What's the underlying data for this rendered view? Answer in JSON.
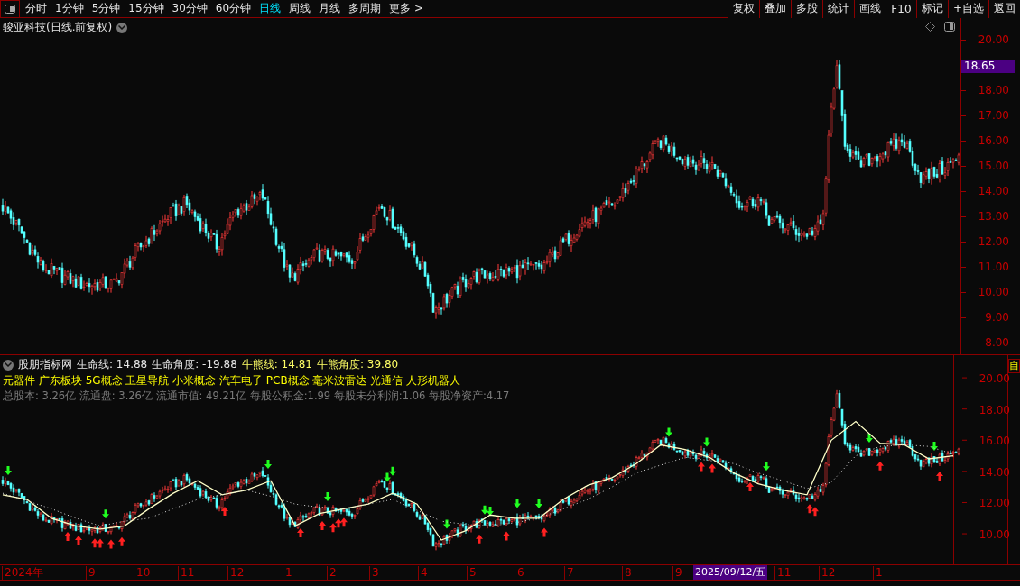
{
  "toolbar": {
    "periods": [
      {
        "label": "分时",
        "selected": false
      },
      {
        "label": "1分钟",
        "selected": false
      },
      {
        "label": "5分钟",
        "selected": false
      },
      {
        "label": "15分钟",
        "selected": false
      },
      {
        "label": "30分钟",
        "selected": false
      },
      {
        "label": "60分钟",
        "selected": false
      },
      {
        "label": "日线",
        "selected": true
      },
      {
        "label": "周线",
        "selected": false
      },
      {
        "label": "月线",
        "selected": false
      },
      {
        "label": "多周期",
        "selected": false
      }
    ],
    "more": "更多 >",
    "buttons": [
      "复权",
      "叠加",
      "多股",
      "统计",
      "画线",
      "F10",
      "标记",
      "+自选",
      "返回"
    ]
  },
  "main_chart": {
    "title": "骏亚科技(日线.前复权)",
    "price_axis": [
      "20.00",
      "18.00",
      "17.00",
      "16.00",
      "15.00",
      "14.00",
      "13.00",
      "12.00",
      "11.00",
      "10.00",
      "9.00",
      "8.00"
    ],
    "current_price": "18.65"
  },
  "indicator": {
    "name": "股朋指标网",
    "readings": [
      {
        "label": "生命线: 14.88",
        "color": "#e8e8e8"
      },
      {
        "label": "生命角度: -19.88",
        "color": "#e8e8e8"
      },
      {
        "label": "牛熊线: 14.81",
        "color": "#ffff66"
      },
      {
        "label": "牛熊角度: 39.80",
        "color": "#ffff66"
      }
    ],
    "concepts": "元器件 广东板块 5G概念 卫星导航 小米概念 汽车电子 PCB概念 毫米波雷达 光通信 人形机器人",
    "fundamentals": "总股本: 3.26亿 流通盘: 3.26亿 流通市值: 49.21亿 每股公积金:1.99 每股未分利润:1.06 每股净资产:4.17",
    "chart_data": {
      "type": "line",
      "ylim": [
        7.98,
        21.45
      ],
      "yticks": [
        {
          "value": 20,
          "label": "20.00"
        },
        {
          "value": 18,
          "label": "18.00"
        },
        {
          "value": 16,
          "label": "16.00"
        },
        {
          "value": 14,
          "label": "14.00"
        },
        {
          "value": 12,
          "label": "12.00"
        },
        {
          "value": 10,
          "label": "10.00"
        }
      ],
      "series": [
        {
          "color": "#ffffc8",
          "values": [
            12.5,
            12.2,
            11.0,
            10.5,
            10.3,
            10.5,
            11.6,
            12.6,
            13.4,
            12.5,
            12.8,
            13.4,
            10.5,
            11.3,
            11.6,
            11.9,
            12.6,
            11.9,
            9.6,
            10.2,
            11.2,
            11.0,
            11.0,
            12.2,
            13.1,
            13.6,
            14.5,
            15.7,
            15.4,
            14.9,
            13.9,
            13.2,
            12.8,
            12.5,
            16.0,
            17.2,
            15.8,
            15.7,
            14.8,
            15.0
          ]
        },
        {
          "color": "#dddddd",
          "line_style": "dotted",
          "values": [
            12.6,
            12.1,
            11.6,
            11.0,
            10.5,
            10.8,
            11.0,
            11.6,
            12.2,
            12.5,
            12.8,
            12.4,
            11.9,
            11.7,
            11.6,
            11.9,
            12.2,
            11.5,
            10.8,
            10.6,
            10.5,
            10.7,
            11.0,
            11.6,
            12.2,
            13.0,
            13.9,
            14.4,
            14.9,
            14.7,
            14.5,
            13.9,
            13.4,
            12.9,
            13.3,
            15.0,
            15.6,
            15.7,
            15.6,
            15.1
          ]
        }
      ]
    }
  },
  "side_tab": "自",
  "date_axis": {
    "labels": [
      "2024年",
      "9",
      "10",
      "11",
      "12",
      "1",
      "2",
      "3",
      "4",
      "5",
      "6",
      "7",
      "8",
      "9"
    ],
    "cursor": "2025/09/12/五",
    "labels_after": [
      "11",
      "12",
      "1"
    ]
  }
}
